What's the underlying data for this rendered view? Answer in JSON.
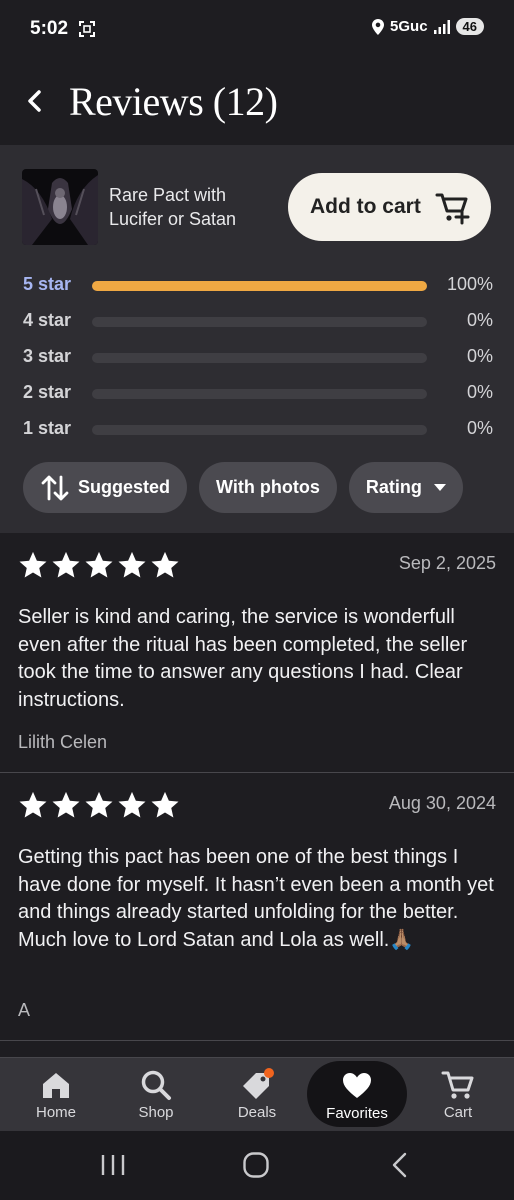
{
  "status_bar": {
    "time": "5:02",
    "network": "5Guc",
    "battery": "46"
  },
  "header": {
    "title": "Reviews (12)"
  },
  "product": {
    "name": "Rare Pact with Lucifer or Satan",
    "add_to_cart_label": "Add to cart"
  },
  "rating_breakdown": [
    {
      "label": "5 star",
      "percent_text": "100%",
      "fraction": 1.0
    },
    {
      "label": "4 star",
      "percent_text": "0%",
      "fraction": 0
    },
    {
      "label": "3 star",
      "percent_text": "0%",
      "fraction": 0
    },
    {
      "label": "2 star",
      "percent_text": "0%",
      "fraction": 0
    },
    {
      "label": "1 star",
      "percent_text": "0%",
      "fraction": 0
    }
  ],
  "filters": {
    "suggested": "Suggested",
    "with_photos": "With photos",
    "rating": "Rating"
  },
  "reviews": [
    {
      "stars": 5,
      "date": "Sep 2, 2025",
      "text": "Seller is kind and caring, the service is wonderfull even after the ritual has been completed, the seller took the time to answer any questions I had. Clear instructions.",
      "author": "Lilith Celen"
    },
    {
      "stars": 5,
      "date": "Aug 30, 2024",
      "text": "Getting this pact has been one of the best things I have done for myself. It hasn’t even been a month yet and things already started unfolding for the better. Much love to Lord Satan and Lola as well.🙏🏽",
      "author": "A"
    }
  ],
  "bottom_nav": {
    "home": "Home",
    "shop": "Shop",
    "deals": "Deals",
    "favorites": "Favorites",
    "cart": "Cart"
  },
  "colors": {
    "accent_bar": "#efa843",
    "active_rating_label": "#a7b6f2",
    "deals_badge": "#f1641e"
  }
}
